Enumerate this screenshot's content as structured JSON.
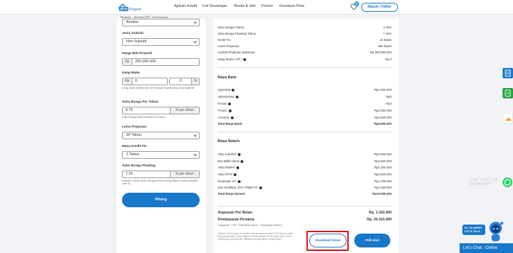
{
  "header": {
    "logo_text": "BTN",
    "logo_subtext": "Properti",
    "nav": [
      "Ajukan Kredit",
      "List Developer",
      "Berita & Info",
      "Promo",
      "Gunakan Peta"
    ],
    "favorites_count": "0",
    "login_label": "Masuk / Daftar"
  },
  "breadcrumb": [
    "Beranda",
    "Simulasi KPR",
    "Konvensional"
  ],
  "form": {
    "top_select_value": "Anuitas",
    "jenis_subsidi_label": "Jenis Subsidi",
    "jenis_subsidi_value": "Non Subsidi",
    "harga_label": "Harga Beli Properti",
    "harga_prefix": "Rp",
    "harga_value": "250.000.000",
    "uang_muka_label": "Uang Muka",
    "uang_muka_prefix": "Rp",
    "uang_muka_value": "0",
    "uang_muka_pct": "0",
    "uang_muka_pct_suffix": "%",
    "uang_muka_note": "Uang muka diambil dari 15% harga properti yang Anda inginkan",
    "suku_bunga_label": "Suku Bunga Per Tahun",
    "suku_bunga_value": "4.75",
    "suku_bunga_suffix": "% per tahun",
    "suku_bunga_note": "Suku Bunga Bank fix selama 20 tahun",
    "lama_label": "Lama Pinjaman",
    "lama_value": "30 Tahun",
    "masa_fix_label": "Masa Kredit Fix",
    "masa_fix_value": "2 Tahun",
    "floating_label": "Suku Bunga Floating",
    "floating_value": "7.25",
    "floating_suffix": "% per tahun",
    "floating_note": "Setelah 1 tahun akan mengikuti Suku Bunga Bank Bi yang Berlaku saat itu",
    "hitung_label": "Hitung"
  },
  "results": {
    "top_rows": [
      {
        "label": "Suku Bunga /Tahun",
        "value": "4.75%"
      },
      {
        "label": "Suku Bunga Floating/ Tahun",
        "value": "7.25%"
      },
      {
        "label": "Kredit Fix",
        "value": "24 Bulan"
      },
      {
        "label": "Lama Pinjaman",
        "value": "360 Bulan"
      },
      {
        "label": "Jumlah Pinjaman Maksimal",
        "value": "Rp 250.000.000"
      },
      {
        "label": "Uang Muka ( DP )",
        "value": "Rp 0"
      }
    ],
    "biaya_bank_title": "Biaya Bank",
    "biaya_bank_rows": [
      {
        "label": "Appraisal",
        "value": "Rp1.500.000"
      },
      {
        "label": "Administrasi",
        "value": "Rp0"
      },
      {
        "label": "Provisi",
        "value": "Rp0"
      },
      {
        "label": "Proses",
        "value": "Rp2.500.000"
      },
      {
        "label": "Asuransi",
        "value": "Rp2.500.000"
      }
    ],
    "biaya_bank_total_label": "Total Biaya Bank",
    "biaya_bank_total_value": "Rp6.500.000",
    "biaya_notaris_title": "Biaya Notaris",
    "biaya_notaris_rows": [
      {
        "label": "Akta Jual Beli",
        "value": "Rp2.500.000"
      },
      {
        "label": "Bea Balik Nama",
        "value": "Rp2.500.000"
      },
      {
        "label": "Akta SKMHT",
        "value": "Rp1.250.000"
      },
      {
        "label": "Akta APHT",
        "value": "Rp2.500.000"
      },
      {
        "label": "Perjanjian HT",
        "value": "Rp1.000.000"
      },
      {
        "label": "Cek Sertifikat, ZNT, PNBP HT",
        "value": "Rp2.250.000"
      }
    ],
    "biaya_notaris_total_label": "Total Biaya Notaris",
    "biaya_notaris_total_value": "Rp12.000.000",
    "angsuran_label": "Angsuran Per Bulan",
    "angsuran_value": "Rp. 1.316.900",
    "pembayaran_label": "Pembayaran Pertama",
    "pembayaran_value": "Rp. 20.316.900",
    "pembayaran_note": "( Angsuran + DP + Total Biaya Bank + Total Biaya Notaris )",
    "disclaimer": "Catatan: Perhitungan ini adalah hasil perkiraan aplikasi KPR secara umum. Data perhitungan di atas dapat berbeda dengan perhitungan bank. Untuk perhitungan yang akurat, silahkan hubungi kantor cabang kami.",
    "detail_button": "Download Detail",
    "unit_button": "Pilih Unit"
  },
  "widgets": {
    "wa_text_1": "LIVE CHAT VIA",
    "wa_text_2": "WHATSAPP",
    "robot_text_1": "HI, I'M HERE!",
    "robot_text_2": "LET'S TALK",
    "chat_bar": "Let's Chat - Online"
  },
  "colors": {
    "brand_blue": "#1877c9",
    "highlight_red": "#e01010",
    "whatsapp_green": "#25d366"
  }
}
